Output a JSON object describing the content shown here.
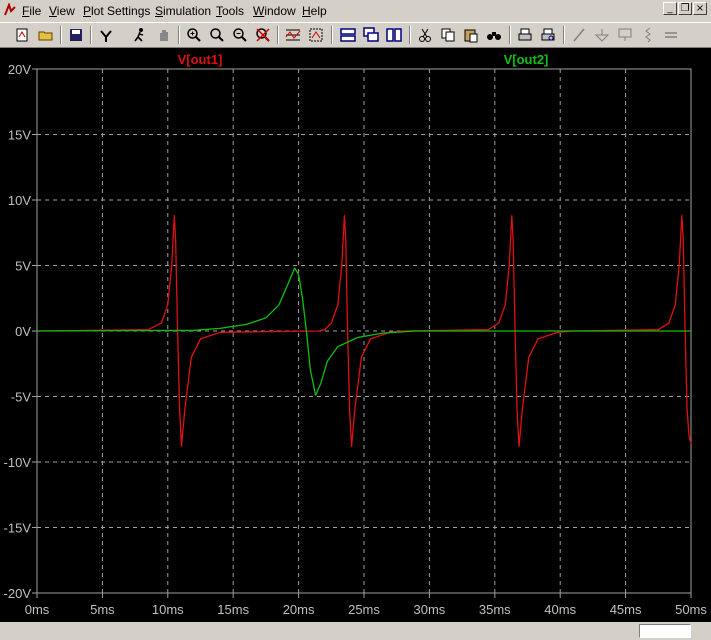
{
  "menu": {
    "items": [
      {
        "label": "File",
        "underline": "F",
        "rest": "ile"
      },
      {
        "label": "View",
        "underline": "V",
        "rest": "iew"
      },
      {
        "label": "Plot Settings",
        "underline": "P",
        "rest": "lot Settings"
      },
      {
        "label": "Simulation",
        "underline": "S",
        "rest": "imulation"
      },
      {
        "label": "Tools",
        "underline": "T",
        "rest": "ools"
      },
      {
        "label": "Window",
        "underline": "W",
        "rest": "indow"
      },
      {
        "label": "Help",
        "underline": "H",
        "rest": "elp"
      }
    ]
  },
  "window_controls": {
    "minimize": "_",
    "restore": "❐",
    "close": "×"
  },
  "toolbar": {
    "icons": [
      "new-schematic-icon",
      "open-folder-icon",
      "save-icon",
      "control-panel-icon",
      "run-icon",
      "pan-hand-icon",
      "zoom-in-icon",
      "zoom-area-icon",
      "zoom-out-icon",
      "zoom-cancel-icon",
      "autorange-icon",
      "fit-icon",
      "tile-horizontal-icon",
      "cascade-icon",
      "tile-vertical-icon",
      "cut-icon",
      "copy-icon",
      "paste-icon",
      "find-icon",
      "print-icon",
      "print-preview-icon",
      "wire-icon",
      "ground-icon",
      "label-icon",
      "resistor-icon",
      "capacitor-icon"
    ]
  },
  "colors": {
    "background": "#000000",
    "grid": "#a0a0a0",
    "axis_text": "#c0c0c0",
    "out1": "#e01010",
    "out2": "#10c010"
  },
  "chart_data": {
    "type": "line",
    "xlabel": "",
    "ylabel": "",
    "xlim": [
      0,
      50
    ],
    "ylim": [
      -20,
      20
    ],
    "x_ticks": [
      "0ms",
      "5ms",
      "10ms",
      "15ms",
      "20ms",
      "25ms",
      "30ms",
      "35ms",
      "40ms",
      "45ms",
      "50ms"
    ],
    "y_ticks": [
      "20V",
      "15V",
      "10V",
      "5V",
      "0V",
      "-5V",
      "-10V",
      "-15V",
      "-20V"
    ],
    "grid": true,
    "series": [
      {
        "name": "V[out1]",
        "color": "#e01010",
        "points": [
          [
            0,
            0
          ],
          [
            8.5,
            0.1
          ],
          [
            9.5,
            0.6
          ],
          [
            10.0,
            2.0
          ],
          [
            10.3,
            5.0
          ],
          [
            10.5,
            8.8
          ],
          [
            10.6,
            7.0
          ],
          [
            10.75,
            0.0
          ],
          [
            10.9,
            -6.0
          ],
          [
            11.05,
            -8.8
          ],
          [
            11.3,
            -6.0
          ],
          [
            11.8,
            -2.0
          ],
          [
            12.5,
            -0.6
          ],
          [
            14.0,
            -0.1
          ],
          [
            21.5,
            0
          ],
          [
            22.0,
            0.1
          ],
          [
            22.5,
            0.6
          ],
          [
            23.0,
            2.0
          ],
          [
            23.3,
            5.0
          ],
          [
            23.5,
            8.8
          ],
          [
            23.6,
            7.0
          ],
          [
            23.75,
            0.0
          ],
          [
            23.9,
            -6.0
          ],
          [
            24.05,
            -8.8
          ],
          [
            24.3,
            -6.0
          ],
          [
            24.8,
            -2.0
          ],
          [
            25.5,
            -0.6
          ],
          [
            27.0,
            -0.1
          ],
          [
            28.0,
            0
          ],
          [
            34.5,
            0.1
          ],
          [
            35.3,
            0.6
          ],
          [
            35.8,
            2.0
          ],
          [
            36.1,
            5.0
          ],
          [
            36.3,
            8.8
          ],
          [
            36.4,
            7.0
          ],
          [
            36.55,
            0.0
          ],
          [
            36.7,
            -6.0
          ],
          [
            36.85,
            -8.8
          ],
          [
            37.1,
            -6.0
          ],
          [
            37.6,
            -2.0
          ],
          [
            38.3,
            -0.6
          ],
          [
            39.8,
            -0.1
          ],
          [
            41.0,
            0
          ],
          [
            47.5,
            0.1
          ],
          [
            48.3,
            0.6
          ],
          [
            48.8,
            2.0
          ],
          [
            49.1,
            5.0
          ],
          [
            49.3,
            8.8
          ],
          [
            49.4,
            7.0
          ],
          [
            49.55,
            0.0
          ],
          [
            49.7,
            -6.0
          ],
          [
            49.85,
            -8.0
          ],
          [
            50,
            -8.6
          ]
        ]
      },
      {
        "name": "V[out2]",
        "color": "#10c010",
        "points": [
          [
            0,
            0
          ],
          [
            12,
            0.05
          ],
          [
            14,
            0.2
          ],
          [
            16,
            0.5
          ],
          [
            17.5,
            1.0
          ],
          [
            18.5,
            2.0
          ],
          [
            19.2,
            3.6
          ],
          [
            19.7,
            4.8
          ],
          [
            20.0,
            4.3
          ],
          [
            20.3,
            2.5
          ],
          [
            20.6,
            0.0
          ],
          [
            20.9,
            -3.0
          ],
          [
            21.3,
            -4.9
          ],
          [
            21.7,
            -4.0
          ],
          [
            22.2,
            -2.3
          ],
          [
            23.0,
            -1.2
          ],
          [
            24.5,
            -0.5
          ],
          [
            26.5,
            -0.15
          ],
          [
            29,
            0
          ],
          [
            50,
            0
          ]
        ]
      }
    ]
  }
}
